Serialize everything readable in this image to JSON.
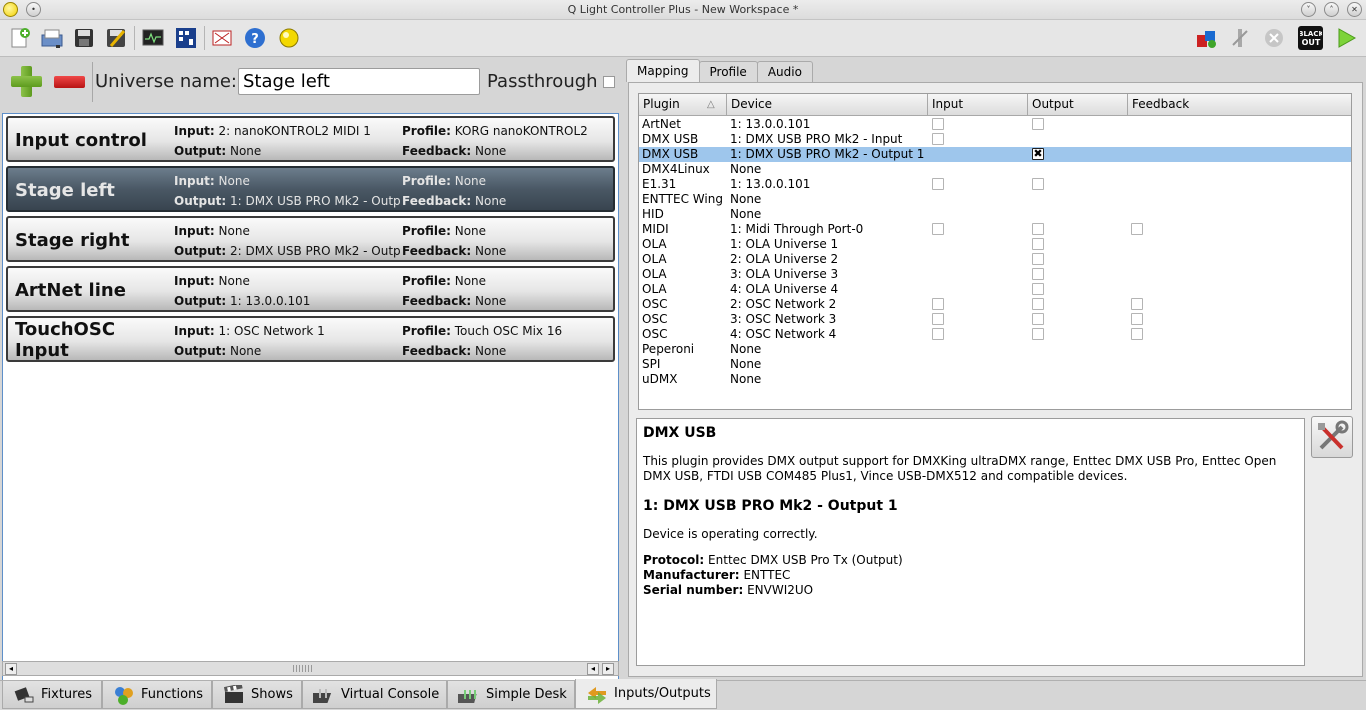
{
  "window": {
    "title": "Q Light Controller Plus - New Workspace *"
  },
  "toolbar": {
    "left_icons": [
      "new-workspace-icon",
      "open-workspace-icon",
      "save-workspace-icon",
      "save-as-icon",
      "monitor-icon",
      "address-tool-icon",
      "full-screen-icon",
      "help-icon",
      "about-icon"
    ],
    "right_icons": [
      "live-edit-icon",
      "grand-master-icon",
      "stop-all-icon",
      "blackout-icon",
      "operate-mode-icon"
    ],
    "blackout_label": "BLACK OUT"
  },
  "universe": {
    "name_label": "Universe name:",
    "name_value": "Stage left",
    "passthrough_label": "Passthrough"
  },
  "universes": [
    {
      "name": "Input control",
      "input_label": "Input:",
      "input": "2: nanoKONTROL2 MIDI 1",
      "output_label": "Output:",
      "output": "None",
      "profile_label": "Profile:",
      "profile": "KORG nanoKONTROL2",
      "feedback_label": "Feedback:",
      "feedback": "None",
      "selected": false
    },
    {
      "name": "Stage left",
      "input_label": "Input:",
      "input": "None",
      "output_label": "Output:",
      "output": "1: DMX USB PRO Mk2 - Outp",
      "profile_label": "Profile:",
      "profile": "None",
      "feedback_label": "Feedback:",
      "feedback": "None",
      "selected": true
    },
    {
      "name": "Stage right",
      "input_label": "Input:",
      "input": "None",
      "output_label": "Output:",
      "output": "2: DMX USB PRO Mk2 - Outp",
      "profile_label": "Profile:",
      "profile": "None",
      "feedback_label": "Feedback:",
      "feedback": "None",
      "selected": false
    },
    {
      "name": "ArtNet line",
      "input_label": "Input:",
      "input": "None",
      "output_label": "Output:",
      "output": "1: 13.0.0.101",
      "profile_label": "Profile:",
      "profile": "None",
      "feedback_label": "Feedback:",
      "feedback": "None",
      "selected": false
    },
    {
      "name": "TouchOSC Input",
      "input_label": "Input:",
      "input": "1: OSC Network 1",
      "output_label": "Output:",
      "output": "None",
      "profile_label": "Profile:",
      "profile": "Touch OSC Mix 16",
      "feedback_label": "Feedback:",
      "feedback": "None",
      "selected": false
    }
  ],
  "right_tabs": [
    "Mapping",
    "Profile",
    "Audio"
  ],
  "mapping": {
    "columns": [
      "Plugin",
      "Device",
      "Input",
      "Output",
      "Feedback"
    ],
    "rows": [
      {
        "plugin": "ArtNet",
        "device": "1: 13.0.0.101",
        "input": "off",
        "output": "off",
        "feedback": ""
      },
      {
        "plugin": "DMX USB",
        "device": "1: DMX USB PRO Mk2 - Input",
        "input": "off",
        "output": "",
        "feedback": ""
      },
      {
        "plugin": "DMX USB",
        "device": "1: DMX USB PRO Mk2 - Output 1",
        "input": "",
        "output": "on",
        "feedback": "",
        "selected": true
      },
      {
        "plugin": "DMX4Linux",
        "device": "None",
        "input": "",
        "output": "",
        "feedback": ""
      },
      {
        "plugin": "E1.31",
        "device": "1: 13.0.0.101",
        "input": "off",
        "output": "off",
        "feedback": ""
      },
      {
        "plugin": "ENTTEC Wing",
        "device": "None",
        "input": "",
        "output": "",
        "feedback": ""
      },
      {
        "plugin": "HID",
        "device": "None",
        "input": "",
        "output": "",
        "feedback": ""
      },
      {
        "plugin": "MIDI",
        "device": "1: Midi Through Port-0",
        "input": "off",
        "output": "off",
        "feedback": "off"
      },
      {
        "plugin": "OLA",
        "device": "1: OLA Universe 1",
        "input": "",
        "output": "off",
        "feedback": ""
      },
      {
        "plugin": "OLA",
        "device": "2: OLA Universe 2",
        "input": "",
        "output": "off",
        "feedback": ""
      },
      {
        "plugin": "OLA",
        "device": "3: OLA Universe 3",
        "input": "",
        "output": "off",
        "feedback": ""
      },
      {
        "plugin": "OLA",
        "device": "4: OLA Universe 4",
        "input": "",
        "output": "off",
        "feedback": ""
      },
      {
        "plugin": "OSC",
        "device": "2: OSC Network 2",
        "input": "off",
        "output": "off",
        "feedback": "off"
      },
      {
        "plugin": "OSC",
        "device": "3: OSC Network 3",
        "input": "off",
        "output": "off",
        "feedback": "off"
      },
      {
        "plugin": "OSC",
        "device": "4: OSC Network 4",
        "input": "off",
        "output": "off",
        "feedback": "off"
      },
      {
        "plugin": "Peperoni",
        "device": "None",
        "input": "",
        "output": "",
        "feedback": ""
      },
      {
        "plugin": "SPI",
        "device": "None",
        "input": "",
        "output": "",
        "feedback": ""
      },
      {
        "plugin": "uDMX",
        "device": "None",
        "input": "",
        "output": "",
        "feedback": ""
      }
    ]
  },
  "info": {
    "plugin_title": "DMX USB",
    "description": "This plugin provides DMX output support for DMXKing ultraDMX range, Enttec DMX USB Pro, Enttec Open DMX USB, FTDI USB COM485 Plus1, Vince USB-DMX512 and compatible devices.",
    "device_title": "1: DMX USB PRO Mk2 - Output 1",
    "status": "Device is operating correctly.",
    "protocol_label": "Protocol:",
    "protocol": "Enttec DMX USB Pro Tx (Output)",
    "manufacturer_label": "Manufacturer:",
    "manufacturer": "ENTTEC",
    "serial_label": "Serial number:",
    "serial": "ENVWI2UO"
  },
  "bottom_tabs": [
    {
      "label": "Fixtures",
      "icon": "fixtures-icon"
    },
    {
      "label": "Functions",
      "icon": "functions-icon"
    },
    {
      "label": "Shows",
      "icon": "shows-icon"
    },
    {
      "label": "Virtual Console",
      "icon": "virtual-console-icon"
    },
    {
      "label": "Simple Desk",
      "icon": "simple-desk-icon"
    },
    {
      "label": "Inputs/Outputs",
      "icon": "inputs-outputs-icon",
      "active": true
    }
  ]
}
